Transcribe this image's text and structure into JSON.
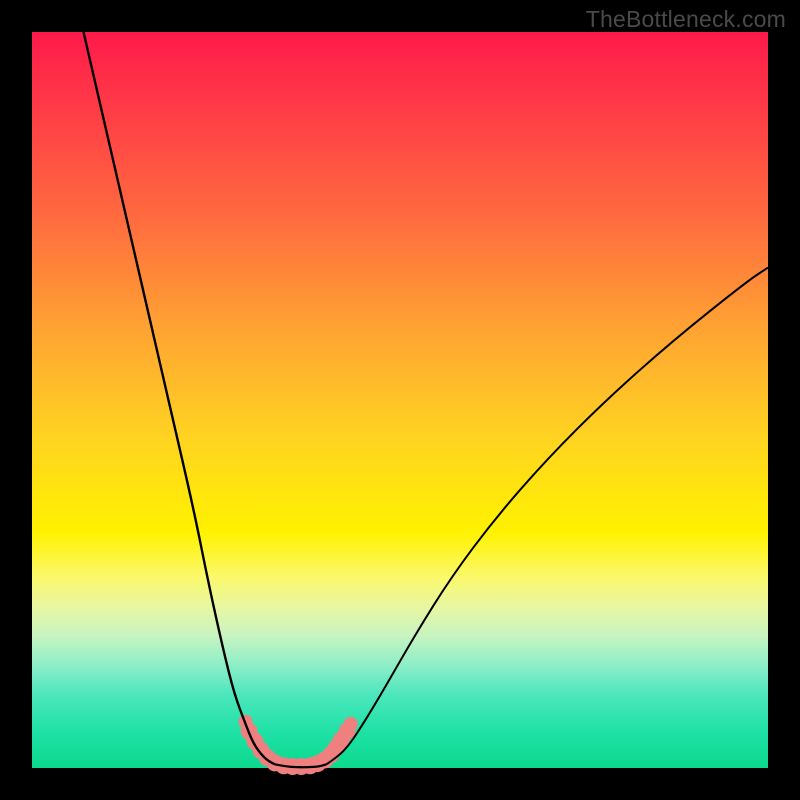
{
  "watermark": "TheBottleneck.com",
  "chart_data": {
    "type": "line",
    "title": "",
    "xlabel": "",
    "ylabel": "",
    "xlim": [
      0,
      100
    ],
    "ylim": [
      0,
      100
    ],
    "grid": false,
    "background_gradient": {
      "top": "#ff1a4a",
      "middle": "#fff200",
      "bottom": "#0cd98d"
    },
    "series": [
      {
        "name": "left-curve",
        "color": "#000000",
        "x": [
          7,
          10,
          13,
          16,
          19,
          22,
          24,
          26,
          27.5,
          29,
          30,
          31,
          32,
          33
        ],
        "y": [
          100,
          87,
          74,
          61,
          48,
          35,
          25,
          16,
          10,
          6,
          3.5,
          2,
          1,
          0.5
        ]
      },
      {
        "name": "right-curve",
        "color": "#000000",
        "x": [
          40,
          41.5,
          43,
          45,
          48,
          52,
          57,
          63,
          70,
          78,
          87,
          97,
          100
        ],
        "y": [
          0.5,
          1.5,
          3,
          6,
          11,
          18,
          26,
          34,
          42,
          50,
          58,
          66,
          68
        ]
      },
      {
        "name": "valley-floor",
        "color": "#000000",
        "x": [
          33,
          34.5,
          36,
          37.5,
          39,
          40
        ],
        "y": [
          0.5,
          0.2,
          0.1,
          0.1,
          0.2,
          0.5
        ]
      },
      {
        "name": "pink-markers",
        "color": "#f08080",
        "type": "scatter",
        "x": [
          29.5,
          30.3,
          31.1,
          32.0,
          33.0,
          34.2,
          35.4,
          36.6,
          37.8,
          38.8,
          39.8,
          40.6,
          41.3,
          42.0,
          42.8
        ],
        "y": [
          5.0,
          3.6,
          2.4,
          1.4,
          0.7,
          0.3,
          0.2,
          0.2,
          0.3,
          0.6,
          1.1,
          1.8,
          2.7,
          3.8,
          5.0
        ]
      }
    ]
  }
}
